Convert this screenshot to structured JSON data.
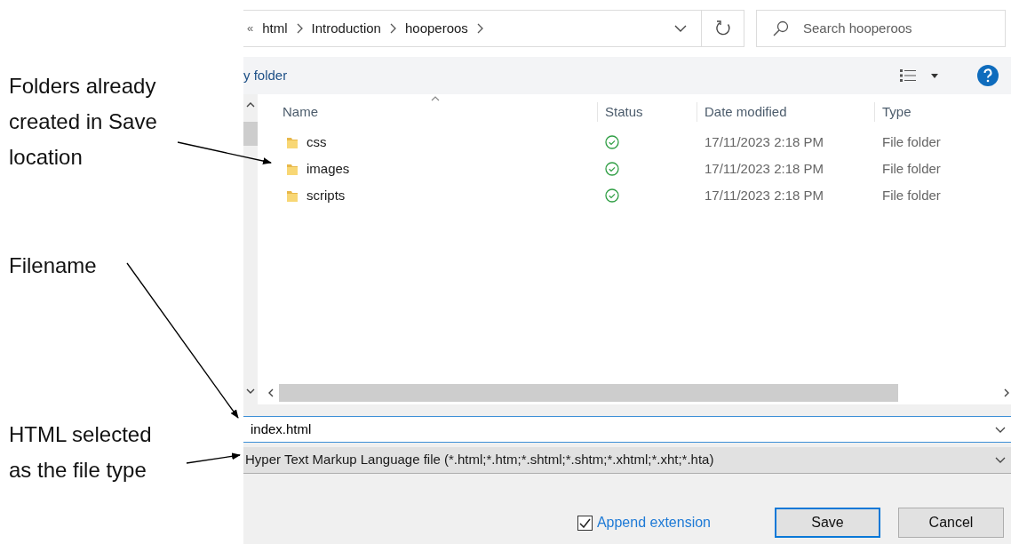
{
  "annotations": [
    {
      "lines": [
        "Folders already",
        "created in Save",
        "location"
      ]
    },
    {
      "lines": [
        "Filename"
      ]
    },
    {
      "lines": [
        "HTML selected",
        "as the file type"
      ]
    }
  ],
  "address_bar": {
    "overflow": "«",
    "crumbs": [
      "html",
      "Introduction",
      "hooperoos"
    ]
  },
  "search": {
    "placeholder": "Search hooperoos"
  },
  "toolbar": {
    "new_folder": "y folder"
  },
  "columns": [
    "Name",
    "Status",
    "Date modified",
    "Type"
  ],
  "rows": [
    {
      "name": "css",
      "synced": true,
      "date": "17/11/2023 2:18 PM",
      "type": "File folder"
    },
    {
      "name": "images",
      "synced": true,
      "date": "17/11/2023 2:18 PM",
      "type": "File folder"
    },
    {
      "name": "scripts",
      "synced": true,
      "date": "17/11/2023 2:18 PM",
      "type": "File folder"
    }
  ],
  "filename": {
    "value": "index.html"
  },
  "file_type": {
    "value": "Hyper Text Markup Language file (*.html;*.htm;*.shtml;*.shtm;*.xhtml;*.xht;*.hta)"
  },
  "append_extension": {
    "label": "Append extension",
    "checked": true
  },
  "buttons": [
    {
      "label": "Save",
      "kind": "default"
    },
    {
      "label": "Cancel",
      "kind": "normal"
    }
  ]
}
